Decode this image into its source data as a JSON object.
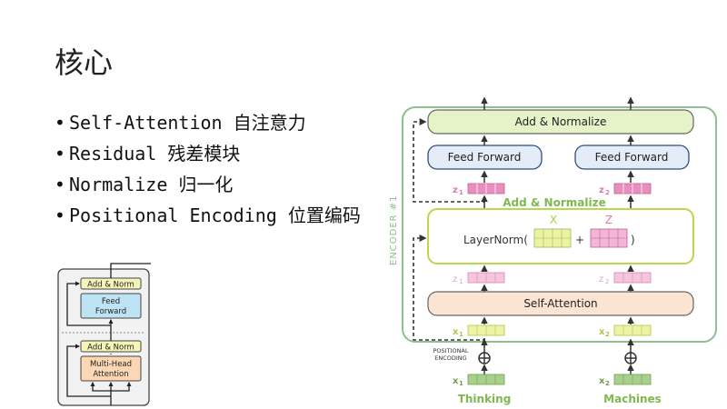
{
  "slide": {
    "title": "核心",
    "bullets": [
      "Self-Attention 自注意力",
      "Residual 残差模块",
      "Normalize 归一化",
      "Positional Encoding 位置编码"
    ]
  },
  "small_diagram": {
    "add_norm_top": "Add & Norm",
    "feed_forward_line1": "Feed",
    "feed_forward_line2": "Forward",
    "add_norm_bottom": "Add & Norm",
    "attention_line1": "Multi-Head",
    "attention_line2": "Attention"
  },
  "encoder_diagram": {
    "add_normalize_top": "Add & Normalize",
    "feed_forward_left": "Feed Forward",
    "feed_forward_right": "Feed Forward",
    "add_normalize_mid": "Add & Normalize",
    "layernorm_prefix": "LayerNorm(",
    "plus": "+",
    "close_paren": ")",
    "x_label": "X",
    "z_label": "Z",
    "self_attention": "Self-Attention",
    "encoder_label": "ENCODER #1",
    "positional_line1": "POSITIONAL",
    "positional_line2": "ENCODING",
    "z1_top": "z",
    "z1_top_sub": "1",
    "z2_top": "z",
    "z2_top_sub": "2",
    "z1_mid": "z",
    "z1_mid_sub": "1",
    "z2_mid": "z",
    "z2_mid_sub": "2",
    "x1_in": "x",
    "x1_in_sub": "1",
    "x2_in": "x",
    "x2_in_sub": "2",
    "x1_emb": "x",
    "x1_emb_sub": "1",
    "x2_emb": "x",
    "x2_emb_sub": "2",
    "word1": "Thinking",
    "word2": "Machines",
    "colors": {
      "frame": "#8fbf8f",
      "add_norm_fill": "#e6f2c8",
      "layernorm_border": "#b7d94c",
      "feed_forward_fill": "#e4ecf7",
      "feed_forward_border": "#2f4e7a",
      "self_attention_fill": "#fbe4d2",
      "pink_vector": "#e98fbf",
      "green_vector": "#a8d08d",
      "yellow_vector": "#eef2a6",
      "label_green": "#7fb850",
      "label_pink": "#e07ab0"
    }
  }
}
